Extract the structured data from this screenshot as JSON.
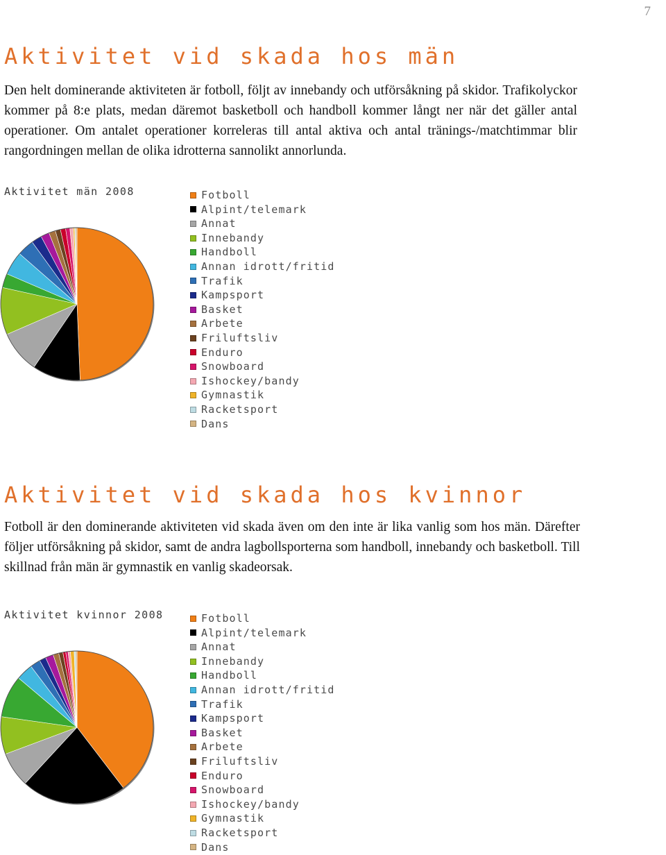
{
  "page_number": "7",
  "accent_color": "#E0702B",
  "sections": [
    {
      "heading": "Aktivitet vid skada hos män",
      "paragraph": "Den helt dominerande aktiviteten är fotboll, följt av innebandy och utförsåkning på skidor. Trafikolyckor kommer på 8:e plats, medan däremot basketboll och handboll kommer långt ner när det gäller antal operationer. Om antalet operationer korreleras till antal aktiva och antal tränings-/matchtimmar blir rangordningen mellan de olika idrotterna sannolikt annorlunda."
    },
    {
      "heading": "Aktivitet vid skada hos kvinnor",
      "paragraph": "Fotboll är den dominerande aktiviteten vid skada även om den inte är lika vanlig som hos män. Därefter följer utförsåkning på skidor, samt de andra lagbollsporterna som handboll, innebandy och basketboll. Till skillnad från män är gymnastik en vanlig skadeorsak."
    }
  ],
  "chart_data": [
    {
      "type": "pie",
      "title": "Aktivitet män 2008",
      "legend_position": "right",
      "categories": [
        "Fotboll",
        "Alpint/telemark",
        "Annat",
        "Innebandy",
        "Handboll",
        "Annan idrott/fritid",
        "Trafik",
        "Kampsport",
        "Basket",
        "Arbete",
        "Friluftsliv",
        "Enduro",
        "Snowboard",
        "Ishockey/bandy",
        "Gymnastik",
        "Racketsport",
        "Dans"
      ],
      "colors": [
        "#F07F16",
        "#000000",
        "#A6A6A6",
        "#92C020",
        "#38A832",
        "#41B7E0",
        "#2E6FB5",
        "#1B2B8C",
        "#A6199C",
        "#A5713E",
        "#6B4220",
        "#C9002B",
        "#D6156B",
        "#F4A8B2",
        "#F0B429",
        "#BEDCE3",
        "#D4B483"
      ],
      "values": [
        49.5,
        10.2,
        9.0,
        10.0,
        3.0,
        5.0,
        3.6,
        2.2,
        1.8,
        1.4,
        1.1,
        1.1,
        0.9,
        0.7,
        0.3,
        0.2,
        0.3
      ],
      "unit": "%",
      "start_angle_deg": 0,
      "direction": "clockwise"
    },
    {
      "type": "pie",
      "title": "Aktivitet kvinnor 2008",
      "legend_position": "right",
      "categories": [
        "Fotboll",
        "Alpint/telemark",
        "Annat",
        "Innebandy",
        "Handboll",
        "Annan idrott/fritid",
        "Trafik",
        "Kampsport",
        "Basket",
        "Arbete",
        "Friluftsliv",
        "Enduro",
        "Snowboard",
        "Ishockey/bandy",
        "Gymnastik",
        "Racketsport",
        "Dans"
      ],
      "colors": [
        "#F07F16",
        "#000000",
        "#A6A6A6",
        "#92C020",
        "#38A832",
        "#41B7E0",
        "#2E6FB5",
        "#1B2B8C",
        "#A6199C",
        "#A5713E",
        "#6B4220",
        "#C9002B",
        "#D6156B",
        "#F4A8B2",
        "#F0B429",
        "#BEDCE3",
        "#D4B483"
      ],
      "values": [
        40.0,
        22.5,
        7.5,
        8.0,
        9.0,
        3.6,
        2.2,
        1.4,
        1.7,
        1.2,
        0.9,
        0.6,
        0.5,
        0.5,
        0.8,
        0.3,
        0.3
      ],
      "unit": "%",
      "start_angle_deg": 0,
      "direction": "clockwise"
    }
  ]
}
